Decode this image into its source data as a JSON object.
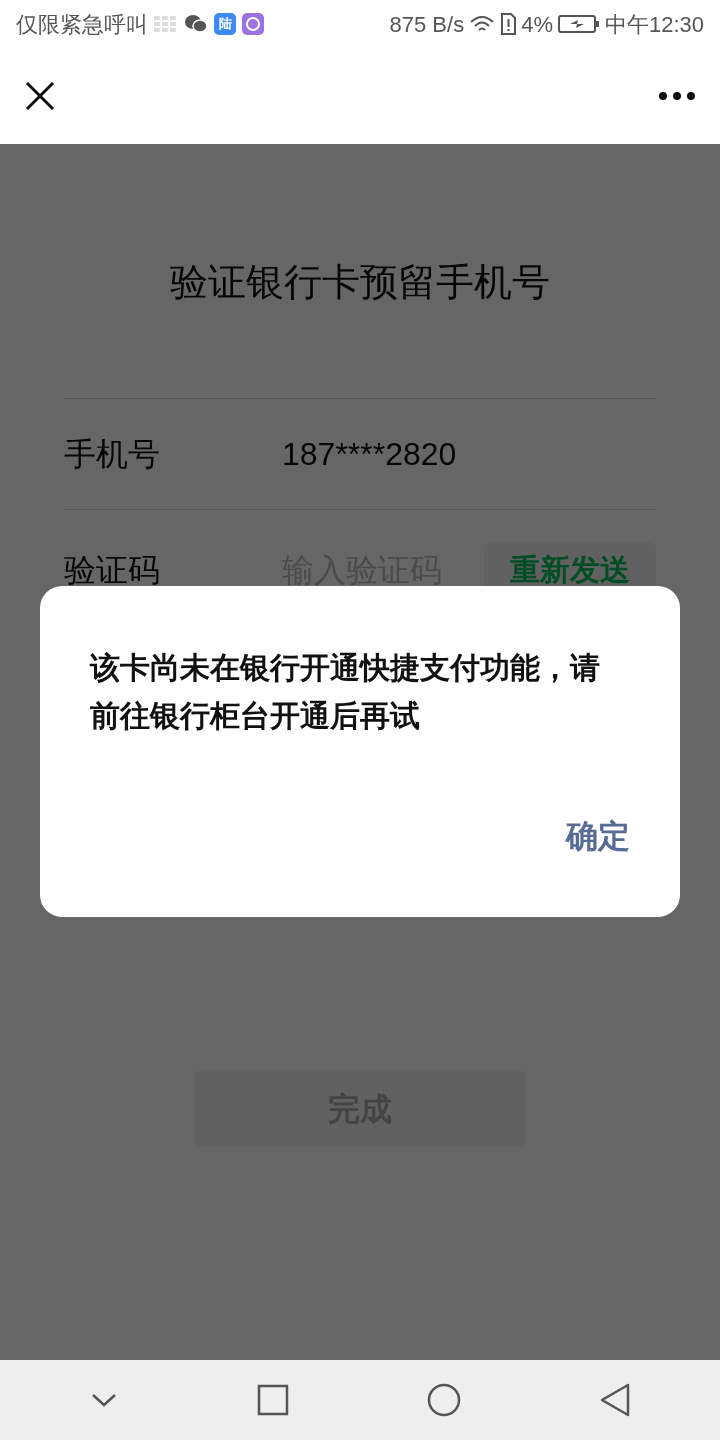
{
  "status_bar": {
    "carrier": "仅限紧急呼叫",
    "app_badge": "陆",
    "speed": "875 B/s",
    "battery": "4%",
    "time": "中午12:30"
  },
  "page": {
    "title": "验证银行卡预留手机号",
    "fields": [
      {
        "label": "手机号",
        "value": "187****2820"
      },
      {
        "label": "验证码",
        "placeholder": "输入验证码",
        "button": "重新发送"
      }
    ],
    "submit": {
      "label": "完成",
      "disabled": true
    }
  },
  "dialog": {
    "message": "该卡尚未在银行开通快捷支付功能，请前往银行柜台开通后再试",
    "confirm": "确定"
  }
}
